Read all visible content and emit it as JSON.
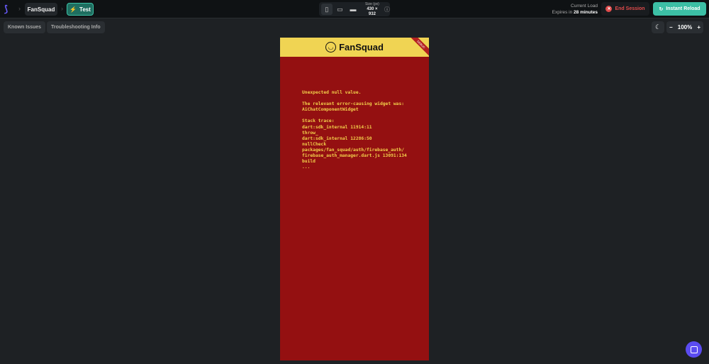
{
  "header": {
    "project": "FanSquad",
    "mode": "Test",
    "size_label": "Size (px)",
    "size_value": "430 × 932",
    "load_label": "Current Load",
    "expires_prefix": "Expires in",
    "expires_value": "28 minutes",
    "end_session": "End Session",
    "instant_reload": "Instant Reload"
  },
  "toolbar": {
    "known_issues": "Known Issues",
    "troubleshooting": "Troubleshooting Info",
    "zoom": "100%"
  },
  "app": {
    "brand": "FanSquad",
    "debug": "DEBUG",
    "error_lines": [
      "Unexpected null value.",
      "",
      "The relevant error-causing widget was:",
      "AiChatComponentWidget",
      "",
      "Stack trace:",
      "dart:sdk_internal 11914:11",
      "throw_",
      "dart:sdk_internal 12286:50",
      "nullCheck",
      "packages/fan_squad/auth/firebase_auth/",
      "firebase_auth_manager.dart.js 13091:134",
      "build",
      "..."
    ]
  },
  "colors": {
    "accent": "#3cbfa5",
    "error_bg": "#941011",
    "appbar": "#f0d453",
    "danger": "#e04b4b"
  }
}
